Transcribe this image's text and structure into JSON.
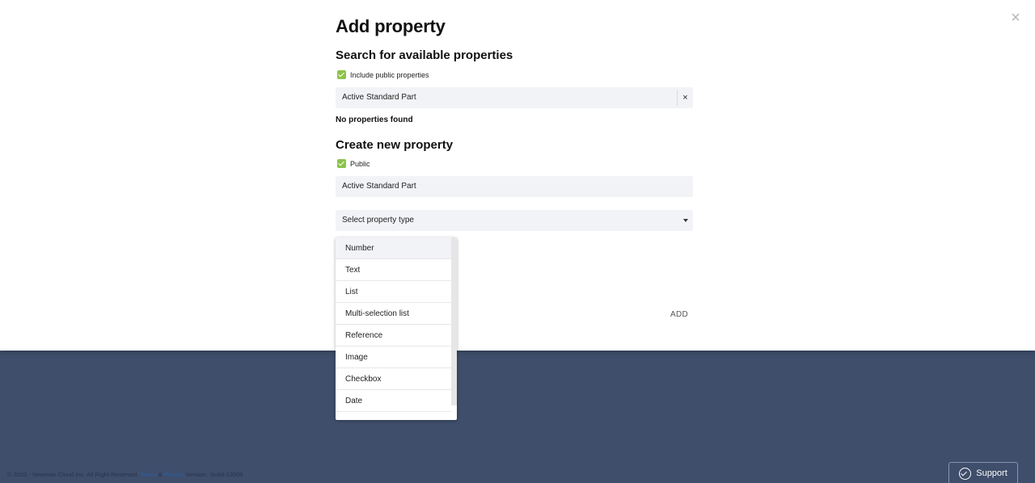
{
  "modal": {
    "title": "Add property",
    "close_icon": "×"
  },
  "search_section": {
    "heading": "Search for available properties",
    "include_public_label": "Include public properties",
    "include_public_checked": true,
    "search_value": "Active Standard Part",
    "clear_icon": "×",
    "empty_message": "No properties found"
  },
  "create_section": {
    "heading": "Create new property",
    "public_label": "Public",
    "public_checked": true,
    "name_value": "Active Standard Part",
    "type_placeholder": "Select property type",
    "add_label": "ADD"
  },
  "type_dropdown": {
    "options": [
      "Number",
      "Text",
      "List",
      "Multi-selection list",
      "Reference",
      "Image",
      "Checkbox",
      "Date"
    ],
    "highlighted_index": 0
  },
  "footer": {
    "copyright": "© 2020 - Newman Cloud Inc. All Right Reserved.",
    "terms": "Terms",
    "amp": "&",
    "privacy": "Privacy",
    "version": "Version: -build-13506"
  },
  "support": {
    "label": "Support",
    "icon": "support-check-icon"
  },
  "colors": {
    "backdrop": "#3f4e6b",
    "checkbox": "#8bc34a",
    "field_bg": "#f2f3f6"
  }
}
